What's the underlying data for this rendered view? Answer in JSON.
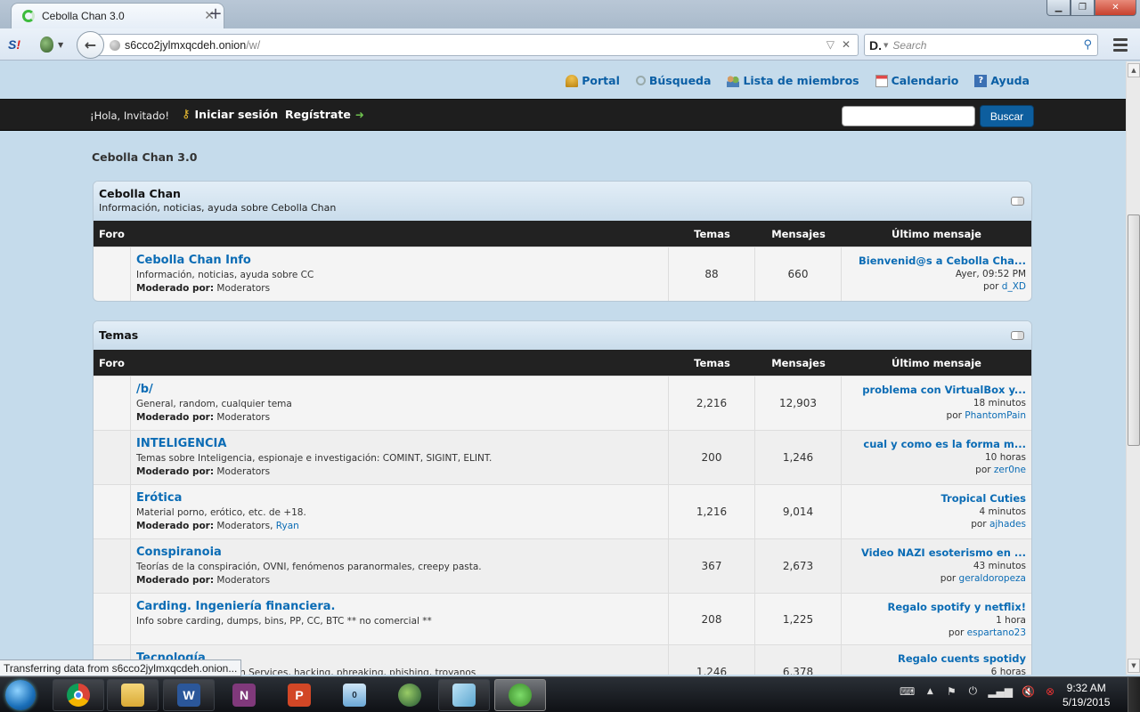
{
  "browser": {
    "tab_title": "Cebolla Chan 3.0",
    "url_host": "s6cco2jylmxqcdeh.onion",
    "url_path": "/w/",
    "search_placeholder": "Search",
    "status_text": "Transferring data from s6cco2jylmxqcdeh.onion..."
  },
  "topnav": [
    {
      "label": "Portal",
      "icon": "bell-icon"
    },
    {
      "label": "Búsqueda",
      "icon": "magnifier-icon"
    },
    {
      "label": "Lista de miembros",
      "icon": "members-icon"
    },
    {
      "label": "Calendario",
      "icon": "calendar-icon"
    },
    {
      "label": "Ayuda",
      "icon": "help-icon"
    }
  ],
  "userbar": {
    "greeting": "¡Hola, Invitado!",
    "login": "Iniciar sesión",
    "register": "Regístrate",
    "search_button": "Buscar",
    "search_value": ""
  },
  "breadcrumb": "Cebolla Chan 3.0",
  "columns": {
    "forum": "Foro",
    "topics": "Temas",
    "posts": "Mensajes",
    "last": "Último mensaje"
  },
  "categories": [
    {
      "title": "Cebolla Chan",
      "description": "Información, noticias, ayuda sobre Cebolla Chan",
      "forums": [
        {
          "name": "Cebolla Chan Info",
          "description": "Información, noticias, ayuda sobre CC",
          "mod_label": "Moderado por:",
          "mods": "Moderators",
          "mods_extra": "",
          "topics": "88",
          "posts": "660",
          "last_title": "Bienvenid@s a Cebolla Cha...",
          "last_time": "Ayer, 09:52 PM",
          "by_label": "por",
          "last_by": "d_XD"
        }
      ]
    },
    {
      "title": "Temas",
      "description": "",
      "forums": [
        {
          "name": "/b/",
          "description": "General, random, cualquier tema",
          "mod_label": "Moderado por:",
          "mods": "Moderators",
          "mods_extra": "",
          "topics": "2,216",
          "posts": "12,903",
          "last_title": "problema con VirtualBox y...",
          "last_time": "18 minutos",
          "by_label": "por",
          "last_by": "PhantomPain"
        },
        {
          "name": "INTELIGENCIA",
          "description": "Temas sobre Inteligencia, espionaje e investigación: COMINT, SIGINT, ELINT.",
          "mod_label": "Moderado por:",
          "mods": "Moderators",
          "mods_extra": "",
          "topics": "200",
          "posts": "1,246",
          "last_title": "cual y como es la forma m...",
          "last_time": "10 horas",
          "by_label": "por",
          "last_by": "zer0ne"
        },
        {
          "name": "Erótica",
          "description": "Material porno, erótico, etc. de +18.",
          "mod_label": "Moderado por:",
          "mods": "Moderators, ",
          "mods_extra": "Ryan",
          "topics": "1,216",
          "posts": "9,014",
          "last_title": "Tropical Cuties",
          "last_time": "4 minutos",
          "by_label": "por",
          "last_by": "ajhades"
        },
        {
          "name": "Conspiranoia",
          "description": "Teorías de la conspiración, OVNI, fenómenos paranormales, creepy pasta.",
          "mod_label": "Moderado por:",
          "mods": "Moderators",
          "mods_extra": "",
          "topics": "367",
          "posts": "2,673",
          "last_title": "Video NAZI esoterismo en ...",
          "last_time": "43 minutos",
          "by_label": "por",
          "last_by": "geraldoropeza"
        },
        {
          "name": "Carding. Ingeniería financiera.",
          "description": "Info sobre carding, dumps, bins, PP, CC, BTC ** no comercial **",
          "mod_label": "",
          "mods": "",
          "mods_extra": "",
          "topics": "208",
          "posts": "1,225",
          "last_title": "Regalo spotify y netflix!",
          "last_time": "1 hora",
          "by_label": "por",
          "last_by": "espartano23"
        },
        {
          "name": "Tecnología",
          "description": "...aciones, TOR, Hidden Services, hacking, phreaking, phishing, troyanos",
          "mod_label": "",
          "mods": "",
          "mods_extra": "",
          "topics": "1,246",
          "posts": "6,378",
          "last_title": "Regalo cuents spotidy",
          "last_time": "6 horas",
          "by_label": "por",
          "last_by": ""
        }
      ]
    }
  ],
  "taskbar": {
    "apps": [
      "Chrome",
      "Explorer",
      "Word",
      "OneNote",
      "PowerPoint",
      "Calculator",
      "Globe app",
      "Notepad",
      "Tor Browser"
    ],
    "time": "9:32 AM",
    "date": "5/19/2015"
  },
  "colors": {
    "link": "#0b6cb5",
    "userbar": "#1e1e1e",
    "page_bg": "#c5dbeb",
    "search_btn": "#0d5e9e"
  }
}
